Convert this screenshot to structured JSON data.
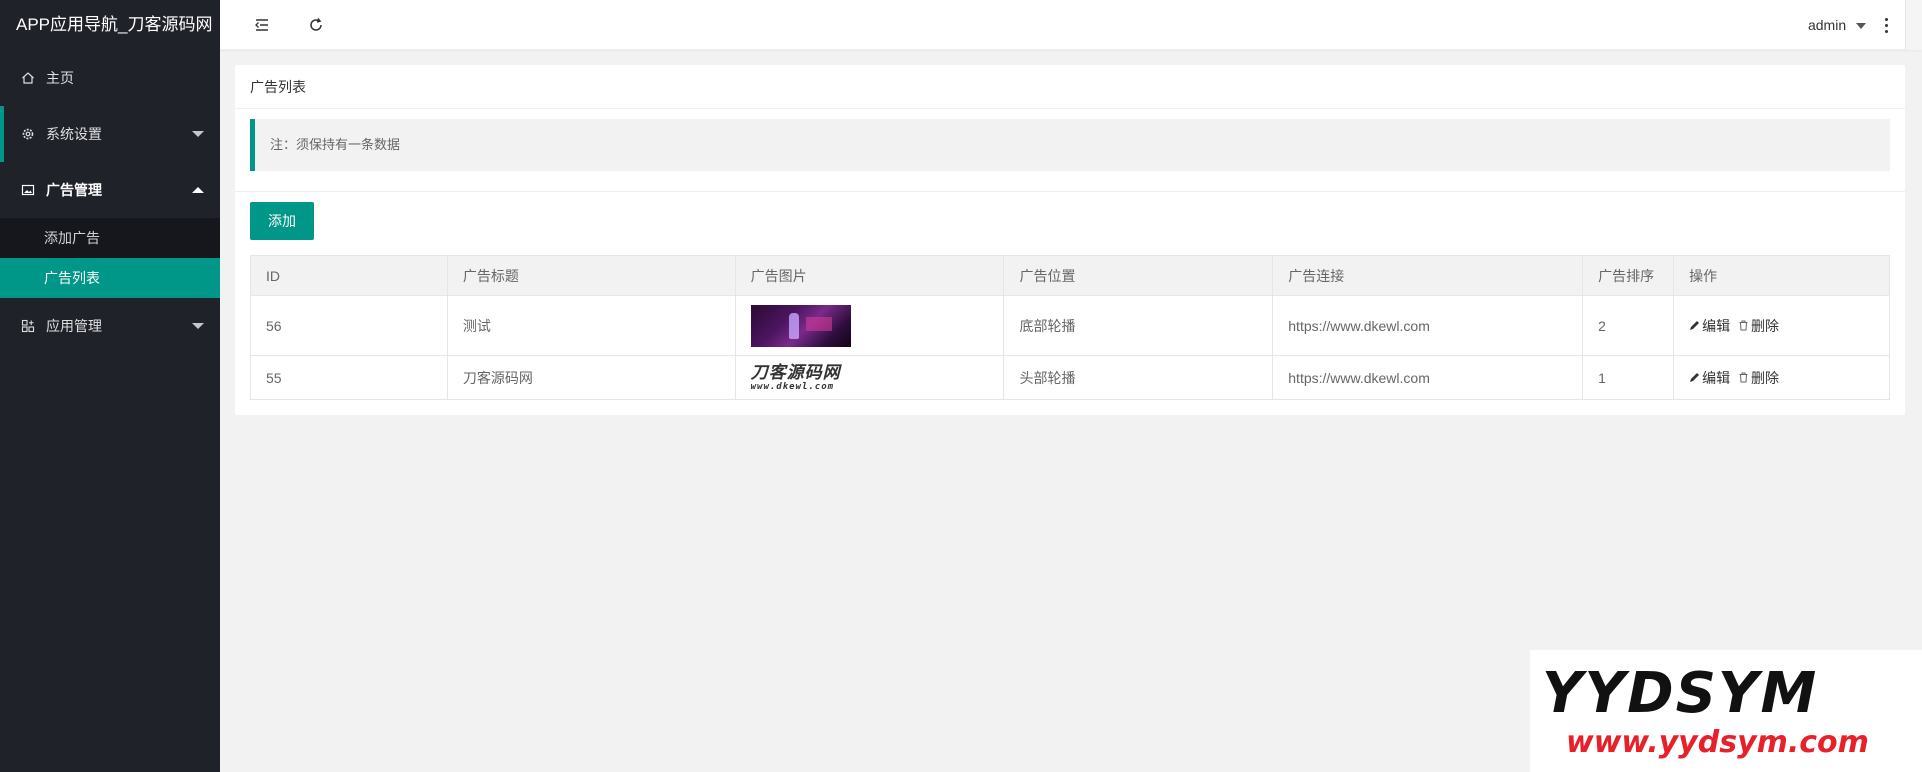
{
  "app": {
    "title": "APP应用导航_刀客源码网"
  },
  "sidebar": {
    "items": [
      {
        "label": "主页",
        "icon": "home-icon"
      },
      {
        "label": "系统设置",
        "icon": "gear-icon"
      },
      {
        "label": "广告管理",
        "icon": "image-icon",
        "children": [
          {
            "label": "添加广告"
          },
          {
            "label": "广告列表"
          }
        ]
      },
      {
        "label": "应用管理",
        "icon": "apps-icon"
      }
    ]
  },
  "header": {
    "user": "admin"
  },
  "main": {
    "card_title": "广告列表",
    "notice": "注：须保持有一条数据",
    "add_label": "添加",
    "table": {
      "columns": [
        "ID",
        "广告标题",
        "广告图片",
        "广告位置",
        "广告连接",
        "广告排序",
        "操作"
      ],
      "rows": [
        {
          "id": "56",
          "title": "测试",
          "image": "photo-thumbnail",
          "position": "底部轮播",
          "link": "https://www.dkewl.com",
          "sort": "2"
        },
        {
          "id": "55",
          "title": "刀客源码网",
          "image_text": "刀客源码网",
          "image_subtext": "www.dkewl.com",
          "position": "头部轮播",
          "link": "https://www.dkewl.com",
          "sort": "1"
        }
      ],
      "actions": {
        "edit": "编辑",
        "delete": "删除"
      }
    }
  },
  "watermark": {
    "top": "YYDSYM",
    "bottom": "www.yydsym.com"
  },
  "colors": {
    "accent": "#009688",
    "sidebar_bg": "#20222a",
    "watermark_red": "#e8202a"
  }
}
